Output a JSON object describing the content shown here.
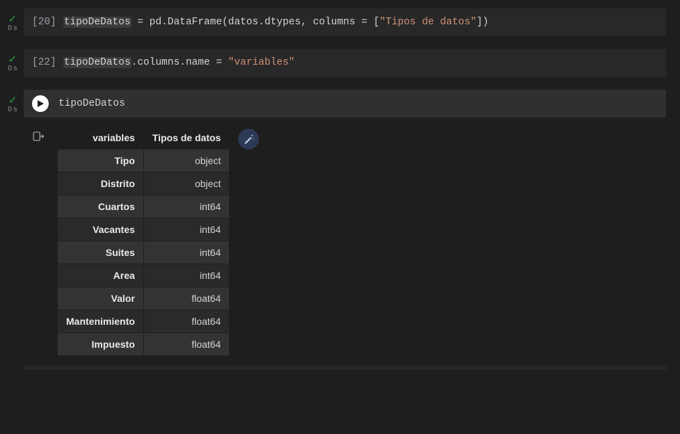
{
  "cells": [
    {
      "status": "ok",
      "timing": "0 s",
      "prompt": "[20]",
      "code_pre": "tipoDeDatos",
      "code_post": " = pd.DataFrame(datos.dtypes, columns = [",
      "code_str": "\"Tipos de datos\"",
      "code_tail": "])"
    },
    {
      "status": "ok",
      "timing": "0 s",
      "prompt": "[22]",
      "code_pre": "tipoDeDatos",
      "code_post": ".columns.name = ",
      "code_str": "\"variables\"",
      "code_tail": ""
    }
  ],
  "active_cell": {
    "status": "ok",
    "timing": "0 s",
    "code": "tipoDeDatos"
  },
  "output": {
    "columns_name": "variables",
    "header": "Tipos de datos",
    "rows": [
      {
        "idx": "Tipo",
        "val": "object"
      },
      {
        "idx": "Distrito",
        "val": "object"
      },
      {
        "idx": "Cuartos",
        "val": "int64"
      },
      {
        "idx": "Vacantes",
        "val": "int64"
      },
      {
        "idx": "Suites",
        "val": "int64"
      },
      {
        "idx": "Area",
        "val": "int64"
      },
      {
        "idx": "Valor",
        "val": "float64"
      },
      {
        "idx": "Mantenimiento",
        "val": "float64"
      },
      {
        "idx": "Impuesto",
        "val": "float64"
      }
    ]
  }
}
